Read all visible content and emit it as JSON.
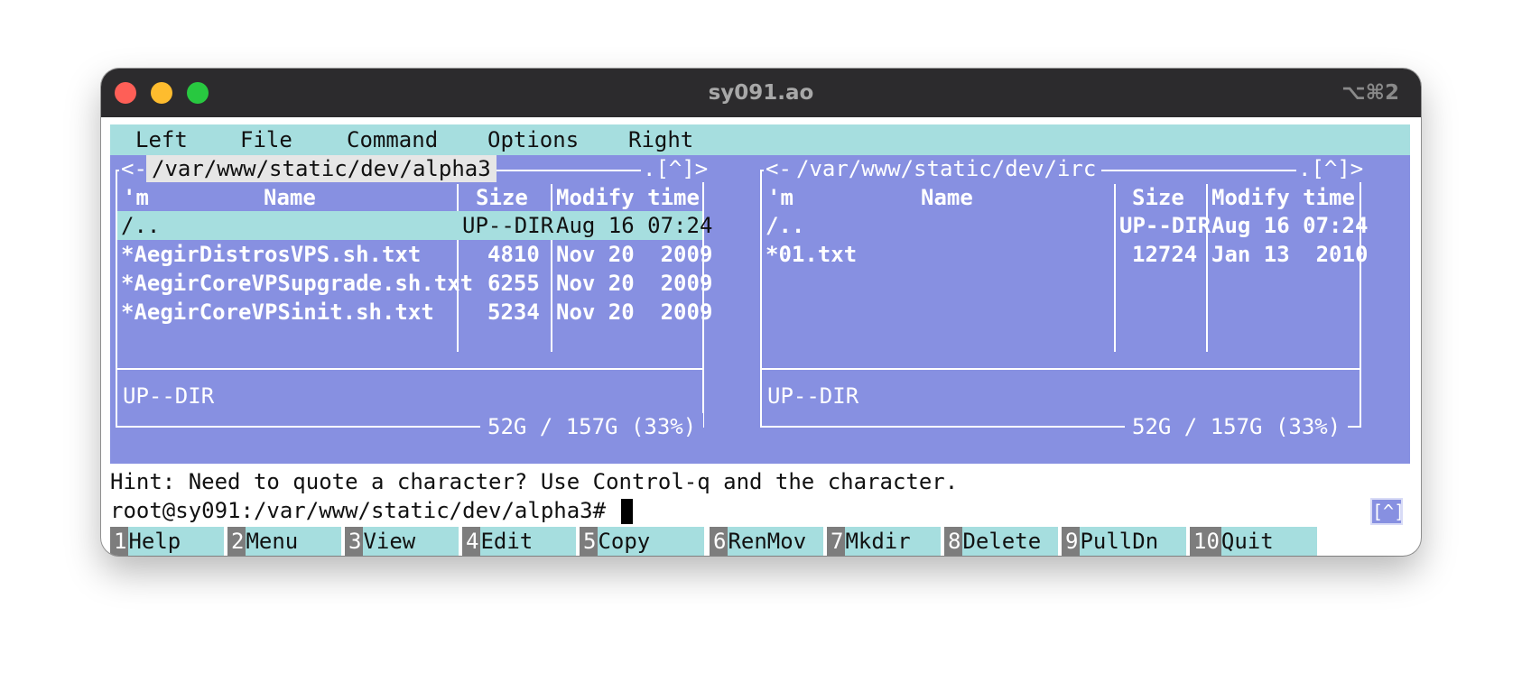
{
  "window": {
    "title": "sy091.ao",
    "shortcut": "⌥⌘2"
  },
  "menu": [
    "Left",
    "File",
    "Command",
    "Options",
    "Right"
  ],
  "left_panel": {
    "path": "/var/www/static/dev/alpha3",
    "nav_left": "<-",
    "nav_right": ".[^]>",
    "headers": {
      "mark": "'m",
      "name": "Name",
      "size": "Size",
      "mtime": "Modify time"
    },
    "rows": [
      {
        "name": "/..",
        "size": "UP--DIR",
        "mtime": "Aug 16 07:24",
        "selected": true
      },
      {
        "name": "*AegirDistrosVPS.sh.txt",
        "size": "4810",
        "mtime": "Nov 20  2009"
      },
      {
        "name": "*AegirCoreVPSupgrade.sh.txt",
        "size": "6255",
        "mtime": "Nov 20  2009"
      },
      {
        "name": "*AegirCoreVPSinit.sh.txt",
        "size": "5234",
        "mtime": "Nov 20  2009"
      }
    ],
    "status": "UP--DIR",
    "usage": "52G / 157G (33%)"
  },
  "right_panel": {
    "path": "/var/www/static/dev/irc",
    "nav_left": "<-",
    "nav_right": ".[^]>",
    "headers": {
      "mark": "'m",
      "name": "Name",
      "size": "Size",
      "mtime": "Modify time"
    },
    "rows": [
      {
        "name": "/..",
        "size": "UP--DIR",
        "mtime": "Aug 16 07:24"
      },
      {
        "name": "*01.txt",
        "size": "12724",
        "mtime": "Jan 13  2010"
      }
    ],
    "status": "UP--DIR",
    "usage": "52G / 157G (33%)"
  },
  "hint": "Hint: Need to quote a character?  Use Control-q and the character.",
  "prompt": "root@sy091:/var/www/static/dev/alpha3#",
  "history_button": "[^]",
  "fkeys": [
    {
      "num": "1",
      "label": "Help"
    },
    {
      "num": "2",
      "label": "Menu"
    },
    {
      "num": "3",
      "label": "View"
    },
    {
      "num": "4",
      "label": "Edit"
    },
    {
      "num": "5",
      "label": "Copy"
    },
    {
      "num": "6",
      "label": "RenMov"
    },
    {
      "num": "7",
      "label": "Mkdir"
    },
    {
      "num": "8",
      "label": "Delete"
    },
    {
      "num": "9",
      "label": "PullDn"
    },
    {
      "num": "10",
      "label": "Quit"
    }
  ]
}
